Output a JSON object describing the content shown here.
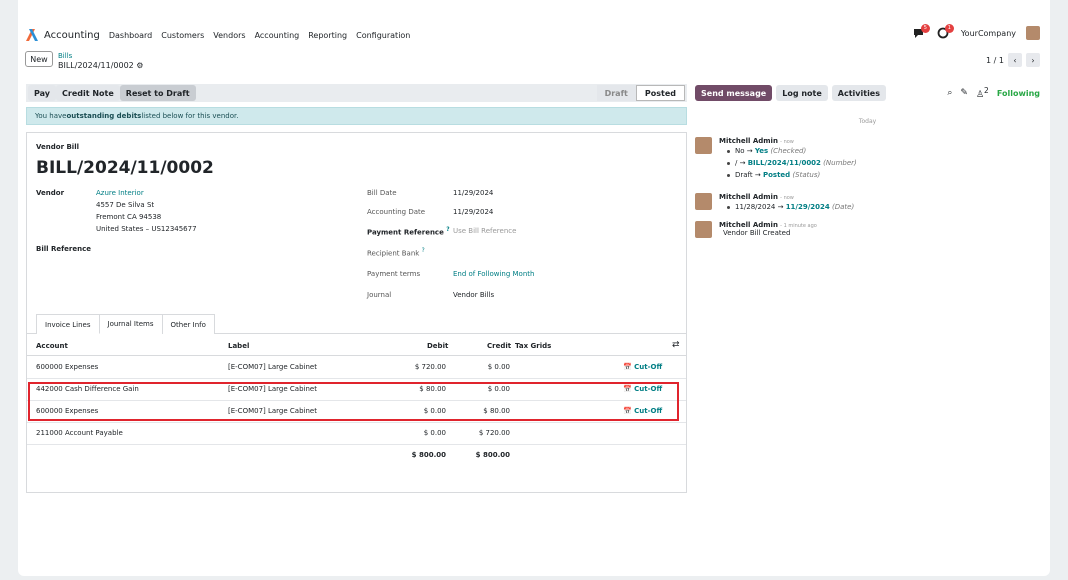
{
  "nav": {
    "app_name": "Accounting",
    "menus": [
      "Dashboard",
      "Customers",
      "Vendors",
      "Accounting",
      "Reporting",
      "Configuration"
    ]
  },
  "topbar": {
    "messages_count": "5",
    "activities_count": "1",
    "company": "YourCompany"
  },
  "control": {
    "new_label": "New",
    "breadcrumb_parent": "Bills",
    "breadcrumb_current": "BILL/2024/11/0002",
    "pager": "1 / 1"
  },
  "actions": {
    "pay": "Pay",
    "credit_note": "Credit Note",
    "reset_draft": "Reset to Draft"
  },
  "statusbar": {
    "draft": "Draft",
    "posted": "Posted"
  },
  "alert": {
    "prefix": "You have ",
    "bold": "outstanding debits",
    "suffix": " listed below for this vendor."
  },
  "form": {
    "type_label": "Vendor Bill",
    "title": "BILL/2024/11/0002",
    "vendor_label": "Vendor",
    "vendor_name": "Azure Interior",
    "vendor_addr1": "4557 De Silva St",
    "vendor_addr2": "Fremont CA 94538",
    "vendor_addr3": "United States – US12345677",
    "bill_ref_label": "Bill Reference",
    "bill_date_label": "Bill Date",
    "bill_date": "11/29/2024",
    "acc_date_label": "Accounting Date",
    "acc_date": "11/29/2024",
    "pay_ref_label": "Payment Reference",
    "pay_ref_help": "?",
    "pay_ref_placeholder": "Use Bill Reference",
    "recipient_bank_label": "Recipient Bank",
    "recipient_bank_help": "?",
    "payment_terms_label": "Payment terms",
    "payment_terms": "End of Following Month",
    "journal_label": "Journal",
    "journal": "Vendor Bills"
  },
  "tabs": [
    "Invoice Lines",
    "Journal Items",
    "Other Info"
  ],
  "table": {
    "headers": {
      "account": "Account",
      "label": "Label",
      "debit": "Debit",
      "credit": "Credit",
      "tax_grids": "Tax Grids"
    },
    "rows": [
      {
        "account": "600000 Expenses",
        "label": "[E-COM07] Large Cabinet",
        "debit": "$ 720.00",
        "credit": "$ 0.00",
        "cutoff": "Cut-Off"
      },
      {
        "account": "442000 Cash Difference Gain",
        "label": "[E-COM07] Large Cabinet",
        "debit": "$ 80.00",
        "credit": "$ 0.00",
        "cutoff": "Cut-Off"
      },
      {
        "account": "600000 Expenses",
        "label": "[E-COM07] Large Cabinet",
        "debit": "$ 0.00",
        "credit": "$ 80.00",
        "cutoff": "Cut-Off"
      },
      {
        "account": "211000 Account Payable",
        "label": "",
        "debit": "$ 0.00",
        "credit": "$ 720.00",
        "cutoff": ""
      }
    ],
    "totals": {
      "debit": "$ 800.00",
      "credit": "$ 800.00"
    }
  },
  "chatter": {
    "send_message": "Send message",
    "log_note": "Log note",
    "activities": "Activities",
    "followers_count": "2",
    "following": "Following",
    "today": "Today",
    "messages": [
      {
        "author": "Mitchell Admin",
        "time": "- now",
        "lines": [
          {
            "old": "No",
            "new": "Yes",
            "field": "(Checked)"
          },
          {
            "old": "/",
            "new": "BILL/2024/11/0002",
            "field": "(Number)"
          },
          {
            "old": "Draft",
            "new": "Posted",
            "field": "(Status)"
          }
        ]
      },
      {
        "author": "Mitchell Admin",
        "time": "- now",
        "lines": [
          {
            "old": "11/28/2024",
            "new": "11/29/2024",
            "field": "(Date)"
          }
        ]
      },
      {
        "author": "Mitchell Admin",
        "time": "- 1 minute ago",
        "text": "Vendor Bill Created"
      }
    ]
  }
}
